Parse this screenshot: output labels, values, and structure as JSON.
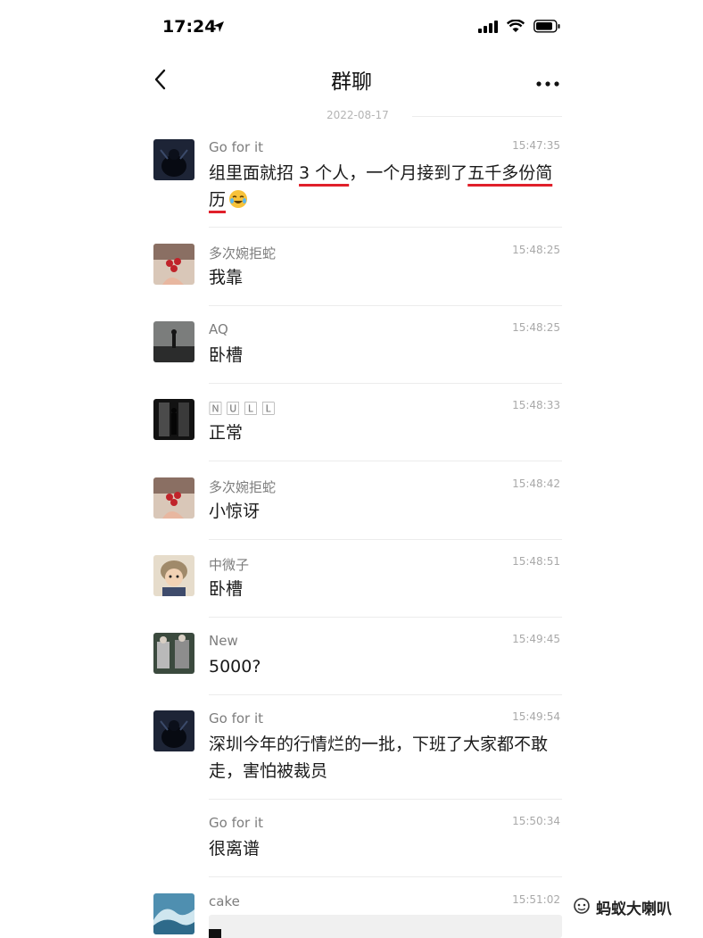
{
  "status_bar": {
    "time": "17:24"
  },
  "header": {
    "title": "群聊"
  },
  "date_separator": "2022-08-17",
  "messages": [
    {
      "sender": "Go for it",
      "time": "15:47:35",
      "text_parts": [
        "组里面就招 ",
        "3 个人",
        "，一个月接到了",
        "五千多份简历"
      ]
    },
    {
      "sender": "多次婉拒蛇",
      "time": "15:48:25",
      "text": "我靠"
    },
    {
      "sender": "AQ",
      "time": "15:48:25",
      "text": "卧槽"
    },
    {
      "sender": "🄽 🅄 🄻 🄻",
      "time": "15:48:33",
      "text": "正常"
    },
    {
      "sender": "多次婉拒蛇",
      "time": "15:48:42",
      "text": "小惊讶"
    },
    {
      "sender": "中微子",
      "time": "15:48:51",
      "text": "卧槽"
    },
    {
      "sender": "New",
      "time": "15:49:45",
      "text": "5000?"
    },
    {
      "sender": "Go for it",
      "time": "15:49:54",
      "text": "深圳今年的行情烂的一批，下班了大家都不敢走，害怕被裁员"
    },
    {
      "sender": "Go for it",
      "time": "15:50:34",
      "text": "很离谱"
    },
    {
      "sender": "cake",
      "time": "15:51:02",
      "text": ""
    }
  ],
  "watermark": {
    "icon": "wechat-channel-icon",
    "text": "蚂蚁大喇叭"
  }
}
